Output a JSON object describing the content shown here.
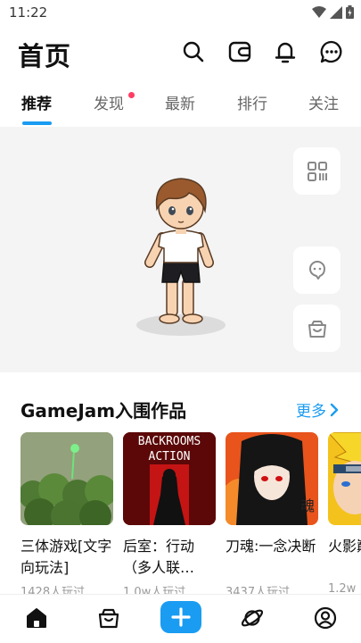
{
  "status_bar": {
    "time": "11:22"
  },
  "header": {
    "title": "首页"
  },
  "tabs": [
    {
      "label": "推荐",
      "active": true,
      "dot": false
    },
    {
      "label": "发现",
      "active": false,
      "dot": true
    },
    {
      "label": "最新",
      "active": false,
      "dot": false
    },
    {
      "label": "排行",
      "active": false,
      "dot": false
    },
    {
      "label": "关注",
      "active": false,
      "dot": false
    }
  ],
  "hero": {
    "side_buttons": [
      {
        "icon": "grid-scan-icon"
      },
      {
        "icon": "ghost-chat-icon"
      },
      {
        "icon": "shopping-bag-icon"
      }
    ]
  },
  "section": {
    "title": "GameJam入围作品",
    "more_label": "更多"
  },
  "cards": [
    {
      "title": "三体游戏[文字向玩法]",
      "players": "1428人玩过"
    },
    {
      "title": "后室：行动（多人联…",
      "players": "1.0w人玩过",
      "thumb_text_1": "BACKROOMS",
      "thumb_text_2": "ACTION"
    },
    {
      "title": "刀魂:一念决断",
      "players": "3437人玩过"
    },
    {
      "title": "火影巅峰",
      "players": "1.2w"
    }
  ],
  "bottom_nav": {
    "items": [
      "home-icon",
      "store-bag-icon",
      "add-icon",
      "planet-icon",
      "profile-icon"
    ]
  },
  "colors": {
    "accent": "#1a9cf2",
    "badge": "#ff3d63"
  }
}
